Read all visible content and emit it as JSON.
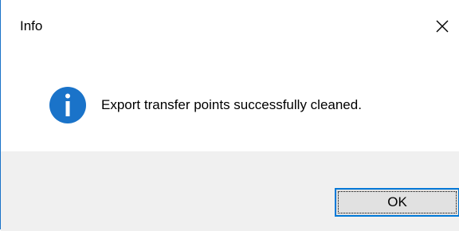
{
  "window": {
    "title": "Info",
    "close_icon": "close-icon",
    "close_glyph": "✕"
  },
  "content": {
    "icon": "info-icon",
    "icon_color": "#1a73c9",
    "message": "Export transfer points successfully cleaned."
  },
  "footer": {
    "ok_label": "OK",
    "ok_border_color": "#0078d7"
  }
}
